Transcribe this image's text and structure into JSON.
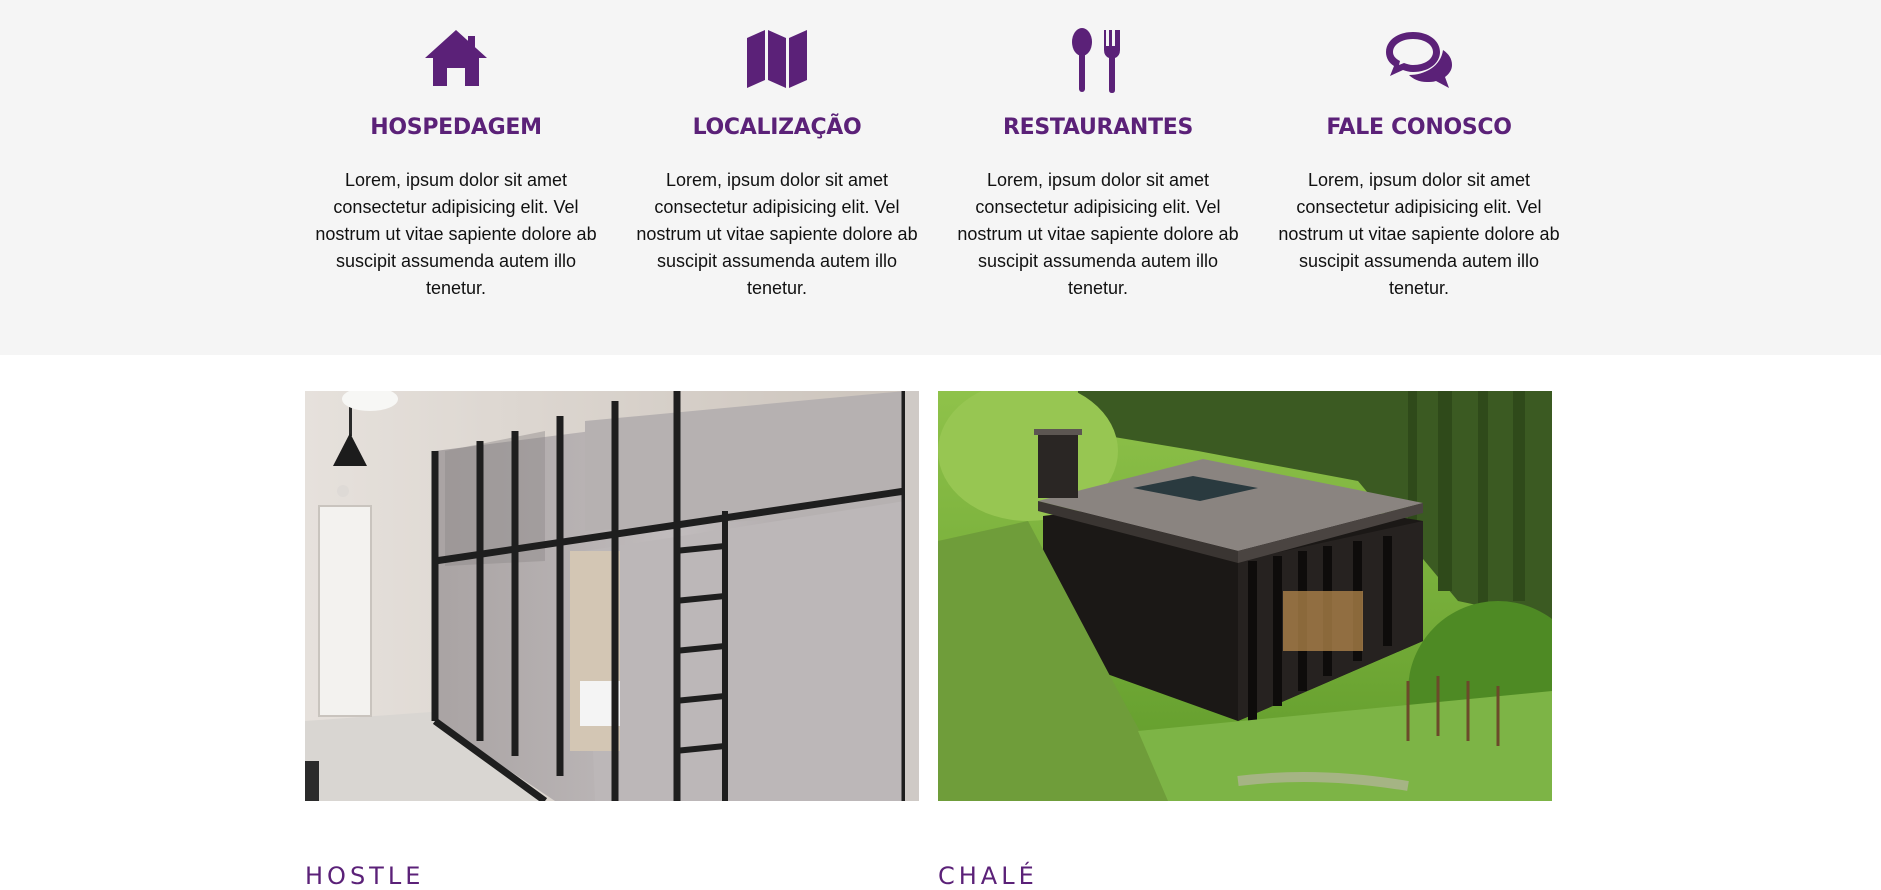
{
  "features": [
    {
      "icon": "house-icon",
      "title": "HOSPEDAGEM",
      "text": "Lorem, ipsum dolor sit amet consectetur adipisicing elit. Vel nostrum ut vitae sapiente dolore ab suscipit assumenda autem illo tenetur."
    },
    {
      "icon": "map-icon",
      "title": "LOCALIZAÇÃO",
      "text": "Lorem, ipsum dolor sit amet consectetur adipisicing elit. Vel nostrum ut vitae sapiente dolore ab suscipit assumenda autem illo tenetur."
    },
    {
      "icon": "utensils-icon",
      "title": "RESTAURANTES",
      "text": "Lorem, ipsum dolor sit amet consectetur adipisicing elit. Vel nostrum ut vitae sapiente dolore ab suscipit assumenda autem illo tenetur."
    },
    {
      "icon": "chat-bubbles-icon",
      "title": "FALE CONOSCO",
      "text": "Lorem, ipsum dolor sit amet consectetur adipisicing elit. Vel nostrum ut vitae sapiente dolore ab suscipit assumenda autem illo tenetur."
    }
  ],
  "cards": [
    {
      "image": "hostel-bunk-beds-photo",
      "title": "HOSTLE"
    },
    {
      "image": "chalet-in-forest-photo",
      "title": "CHALÉ"
    }
  ],
  "colors": {
    "accent": "#5b2178",
    "section_background": "#f5f5f5",
    "body_text": "#111111"
  }
}
